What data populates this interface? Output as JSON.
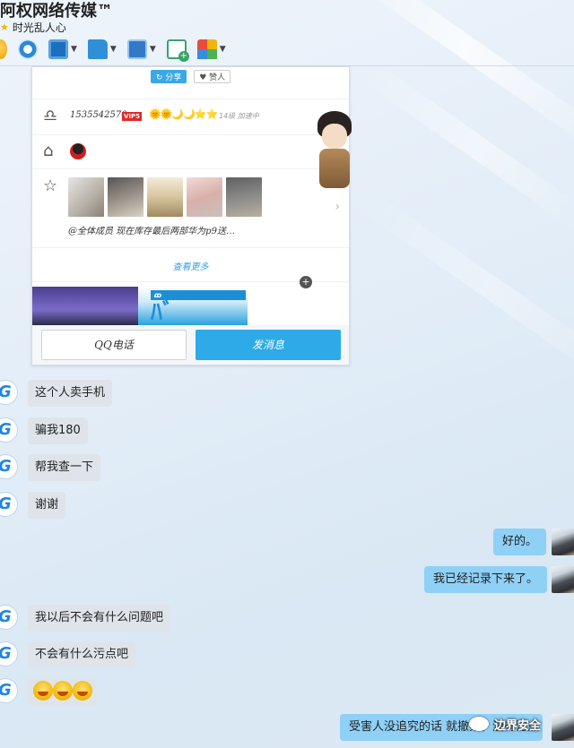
{
  "window": {
    "title": "阿权网络传媒™",
    "subtitle": "时光乱人心"
  },
  "toolbar": {
    "tools": [
      "phone-icon",
      "video-icon",
      "screen-share-icon",
      "file-transfer-icon",
      "remote-desktop-icon",
      "new-chat-icon",
      "apps-icon"
    ]
  },
  "card": {
    "top_pill_left": "↻ 分享",
    "top_pill_right": "♥ 赞人",
    "qq_number": "1535542570",
    "vip_badge": "VIP5",
    "level_icons": "🌞🌞🌙🌙⭐⭐",
    "level_text": "14级 加速中",
    "space_caption": "@全体成员  现在库存最后两部华为p9送…",
    "more_link": "查看更多",
    "call_button": "QQ电话",
    "send_button": "发消息"
  },
  "messages": [
    {
      "side": "left",
      "text": "这个人卖手机"
    },
    {
      "side": "left",
      "text": "骗我180"
    },
    {
      "side": "left",
      "text": "帮我查一下"
    },
    {
      "side": "left",
      "text": "谢谢"
    },
    {
      "side": "right",
      "text": "好的。"
    },
    {
      "side": "right",
      "text": "我已经记录下来了。"
    },
    {
      "side": "left",
      "text": "我以后不会有什么问题吧"
    },
    {
      "side": "left",
      "text": "不会有什么污点吧"
    },
    {
      "side": "left",
      "text": "",
      "emoji_count": 3
    },
    {
      "side": "right",
      "text": "受害人没追究的话 就撤案，没有污点"
    }
  ],
  "watermark": {
    "text": "边界安全"
  },
  "colors": {
    "left_bubble": "#dfe4ea",
    "right_bubble": "#8fd0f7",
    "accent": "#2eaae8"
  }
}
